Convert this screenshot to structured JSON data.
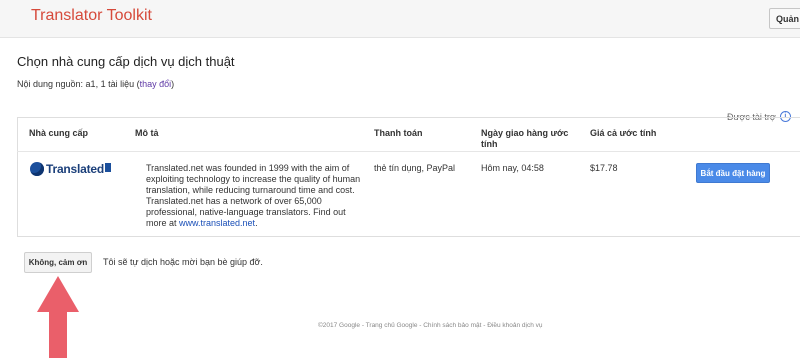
{
  "header": {
    "app_title": "Translator Toolkit",
    "manage_label": "Quản lý"
  },
  "page": {
    "title": "Chọn nhà cung cấp dịch vụ dịch thuật",
    "source_prefix": "Nội dung nguồn: a1, 1 tài liệu (",
    "source_change_link": "thay đổi",
    "source_suffix": ")"
  },
  "sponsored_label": "Được tài trợ",
  "table": {
    "headers": {
      "provider": "Nhà cung cấp",
      "description": "Mô tả",
      "payment": "Thanh toán",
      "delivery": "Ngày giao hàng ước tính",
      "price": "Giá cả ước tính"
    },
    "row": {
      "provider_logo": "Translated",
      "description_text": "Translated.net was founded in 1999 with the aim of exploiting technology to increase the quality of human translation, while reducing turnaround time and cost. Translated.net has a network of over 65,000 professional, native-language translators. Find out more at ",
      "description_link": "www.translated.net",
      "description_end": ".",
      "payment": "thẻ tín dụng, PayPal",
      "delivery": "Hôm nay, 04:58",
      "price": "$17.78",
      "start_button": "Bắt đầu đặt hàng"
    }
  },
  "decline": {
    "button": "Không, cảm ơn",
    "note": "Tôi sẽ tự dịch hoặc mời bạn bè giúp đỡ."
  },
  "footer": "©2017 Google - Trang chủ Google - Chính sách bảo mật - Điều khoản dịch vụ",
  "colors": {
    "title_red": "#d64a3b",
    "button_blue": "#4a8ae8",
    "arrow_red": "#ea5f6a",
    "link_purple": "#5f3aa6"
  }
}
